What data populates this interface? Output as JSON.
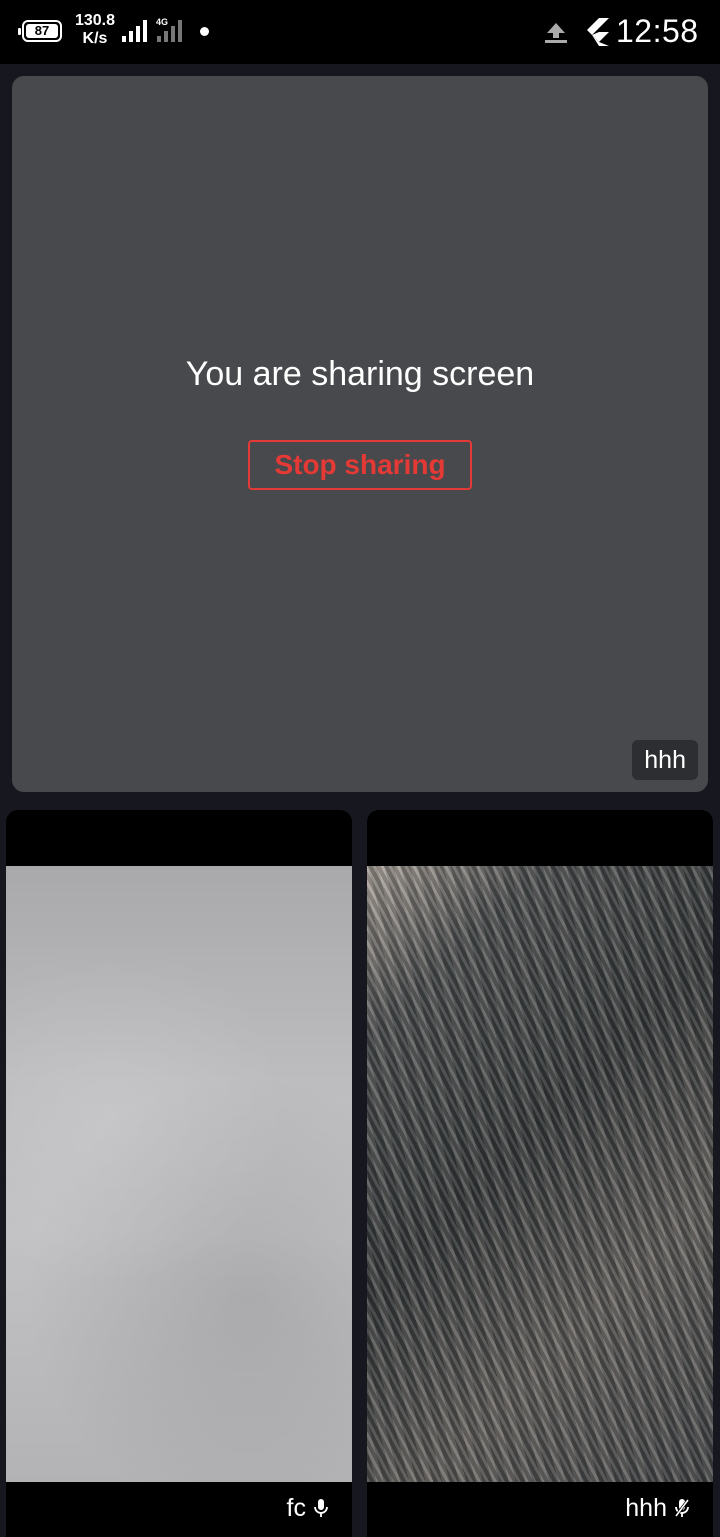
{
  "status_bar": {
    "battery_level": "87",
    "net_speed_value": "130.8",
    "net_speed_unit": "K/s",
    "network_type": "4G",
    "time": "12:58"
  },
  "screen_share": {
    "message": "You are sharing screen",
    "stop_button_label": "Stop sharing",
    "participant_name": "hhh"
  },
  "participants": [
    {
      "name": "fc",
      "mic_state": "on",
      "icon": "mic-icon"
    },
    {
      "name": "hhh",
      "mic_state": "muted",
      "icon": "mic-off-icon"
    }
  ],
  "colors": {
    "background": "#17181f",
    "card": "#48494c",
    "stop_accent": "#e53935"
  }
}
